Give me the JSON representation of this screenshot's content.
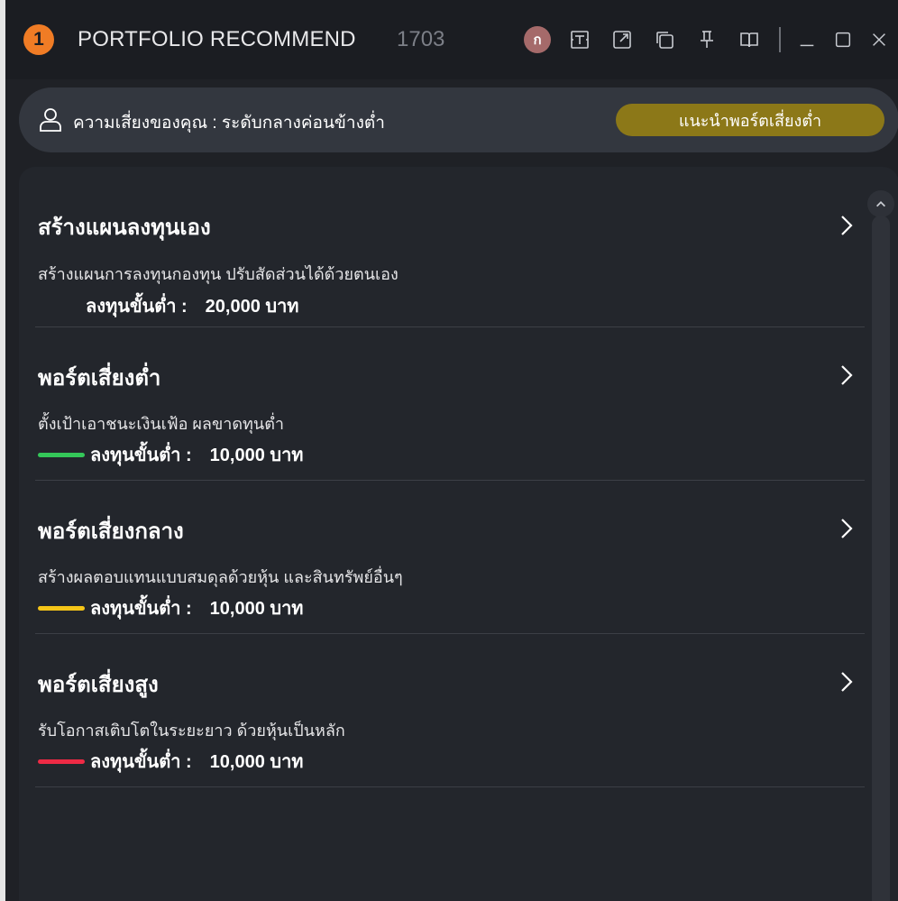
{
  "window": {
    "badge": "1",
    "title": "PORTFOLIO RECOMMEND",
    "code": "1703",
    "avatar_letter": "ก",
    "toolbar_icons": [
      "text-box-icon",
      "external-link-icon",
      "duplicate-icon",
      "pin-icon",
      "book-icon"
    ],
    "window_controls": [
      "minimize-icon",
      "maximize-icon",
      "close-icon"
    ]
  },
  "risk": {
    "text": "ความเสี่ยงของคุณ : ระดับกลางค่อนข้างต่ำ",
    "button_label": "แนะนำพอร์ตเสี่ยงต่ำ",
    "button_color": "#8c7818"
  },
  "items": [
    {
      "title": "สร้างแผนลงทุนเอง",
      "description": "สร้างแผนการลงทุนกองทุน ปรับสัดส่วนได้ด้วยตนเอง",
      "min_label": "ลงทุนขั้นต่ำ :",
      "min_value": "20,000 บาท",
      "indicator_color": ""
    },
    {
      "title": "พอร์ตเสี่ยงต่ำ",
      "description": "ตั้งเป้าเอาชนะเงินเฟ้อ ผลขาดทุนต่ำ",
      "min_label": "ลงทุนขั้นต่ำ :",
      "min_value": "10,000 บาท",
      "indicator_color": "#34c759"
    },
    {
      "title": "พอร์ตเสี่ยงกลาง",
      "description": "สร้างผลตอบแทนแบบสมดุลด้วยหุ้น และสินทรัพย์อื่นๆ",
      "min_label": "ลงทุนขั้นต่ำ :",
      "min_value": "10,000 บาท",
      "indicator_color": "#f5c518"
    },
    {
      "title": "พอร์ตเสี่ยงสูง",
      "description": "รับโอกาสเติบโตในระยะยาว ด้วยหุ้นเป็นหลัก",
      "min_label": "ลงทุนขั้นต่ำ :",
      "min_value": "10,000 บาท",
      "indicator_color": "#ee2a45"
    }
  ],
  "colors": {
    "accent_orange": "#f07c25",
    "background": "#1f2126"
  }
}
